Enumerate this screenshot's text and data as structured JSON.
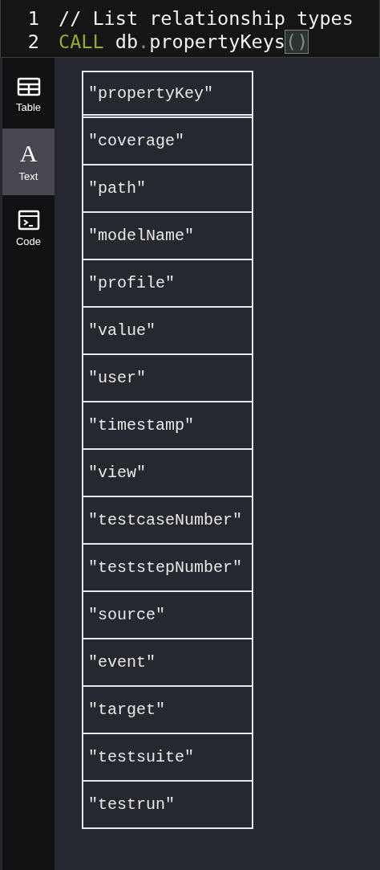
{
  "editor": {
    "lines": [
      {
        "number": "1",
        "tokens": [
          {
            "kind": "comment",
            "text": "// List relationship types"
          }
        ]
      },
      {
        "number": "2",
        "tokens": [
          {
            "kind": "keyword",
            "text": "CALL"
          },
          {
            "kind": "plain",
            "text": " db"
          },
          {
            "kind": "punct",
            "text": "."
          },
          {
            "kind": "plain",
            "text": "propertyKeys"
          },
          {
            "kind": "bracket",
            "text": "()"
          }
        ]
      }
    ]
  },
  "sidebar": {
    "items": [
      {
        "label": "Table",
        "kind": "table",
        "selected": false
      },
      {
        "label": "Text",
        "kind": "text",
        "glyph": "A",
        "selected": true
      },
      {
        "label": "Code",
        "kind": "code",
        "selected": false
      }
    ]
  },
  "result": {
    "header": "\"propertyKey\"",
    "rows": [
      "\"coverage\"",
      "\"path\"",
      "\"modelName\"",
      "\"profile\"",
      "\"value\"",
      "\"user\"",
      "\"timestamp\"",
      "\"view\"",
      "\"testcaseNumber\"",
      "\"teststepNumber\"",
      "\"source\"",
      "\"event\"",
      "\"target\"",
      "\"testsuite\"",
      "\"testrun\""
    ]
  }
}
